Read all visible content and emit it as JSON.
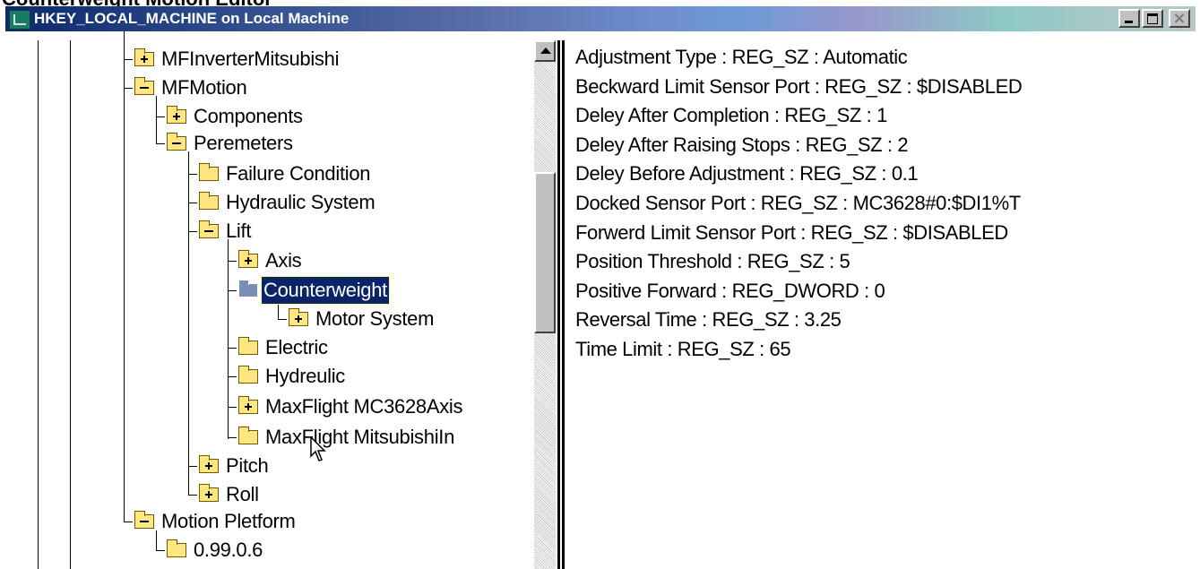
{
  "page": {
    "heading": "Counterweight Motion Editor"
  },
  "window": {
    "title": "HKEY_LOCAL_MACHINE on Local Machine"
  },
  "tree": {
    "items": [
      {
        "label": "MFInverterMitsubishi",
        "folder": "plus"
      },
      {
        "label": "MFMotion",
        "folder": "minus"
      },
      {
        "label": "Components",
        "folder": "plus"
      },
      {
        "label": "Peremeters",
        "folder": "minus"
      },
      {
        "label": "Failure Condition",
        "folder": "plain"
      },
      {
        "label": "Hydraulic System",
        "folder": "plain"
      },
      {
        "label": "Lift",
        "folder": "minus"
      },
      {
        "label": "Axis",
        "folder": "plus"
      },
      {
        "label": "Counterweight",
        "folder": "open",
        "selected": true
      },
      {
        "label": "Motor System",
        "folder": "plus"
      },
      {
        "label": "Electric",
        "folder": "plain"
      },
      {
        "label": "Hydreulic",
        "folder": "plain"
      },
      {
        "label": "MaxFlight MC3628Axis",
        "folder": "plus"
      },
      {
        "label": "MaxFlight MitsubishiIn",
        "folder": "plain"
      },
      {
        "label": "Pitch",
        "folder": "plus"
      },
      {
        "label": "Roll",
        "folder": "plus"
      },
      {
        "label": "Motion Pletform",
        "folder": "minus"
      },
      {
        "label": "0.99.0.6",
        "folder": "plain"
      }
    ]
  },
  "values": [
    "Adjustment Type : REG_SZ : Automatic",
    "Beckward Limit Sensor Port : REG_SZ : $DISABLED",
    "Deley After Completion : REG_SZ : 1",
    "Deley After Raising Stops : REG_SZ : 2",
    "Deley Before Adjustment : REG_SZ : 0.1",
    "Docked Sensor Port : REG_SZ : MC3628#0:$DI1%T",
    "Forwerd Limit Sensor Port : REG_SZ : $DISABLED",
    "Position Threshold : REG_SZ : 5",
    "Positive Forward : REG_DWORD : 0",
    "Reversal Time : REG_SZ : 3.25",
    "Time Limit : REG_SZ : 65"
  ]
}
